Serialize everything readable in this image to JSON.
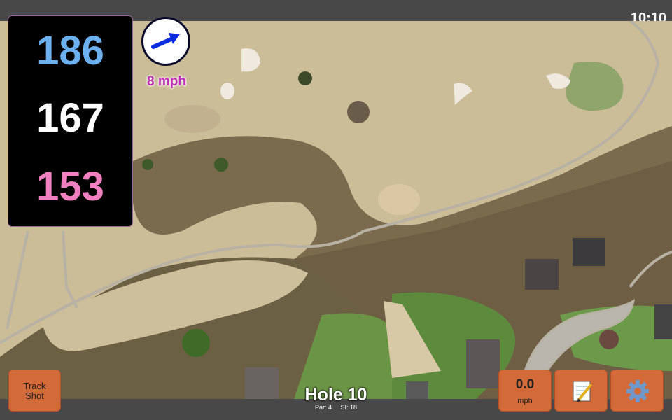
{
  "status_bar": {
    "time": "10:10"
  },
  "distances": {
    "back": "186",
    "middle": "167",
    "front": "153"
  },
  "distance_colors": {
    "back": "#6cb0f0",
    "middle": "#ffffff",
    "front": "#f080c0"
  },
  "wind": {
    "speed_label": "8 mph",
    "direction_icon": "arrow-icon"
  },
  "hole": {
    "title": "Hole 10",
    "par_label": "Par: 4",
    "si_label": "SI: 18"
  },
  "buttons": {
    "track_shot_line1": "Track",
    "track_shot_line2": "Shot",
    "speed_value": "0.0",
    "speed_unit": "mph",
    "notes_icon": "notepad-icon",
    "settings_icon": "gear-icon"
  },
  "accent_color": "#d26a3a"
}
